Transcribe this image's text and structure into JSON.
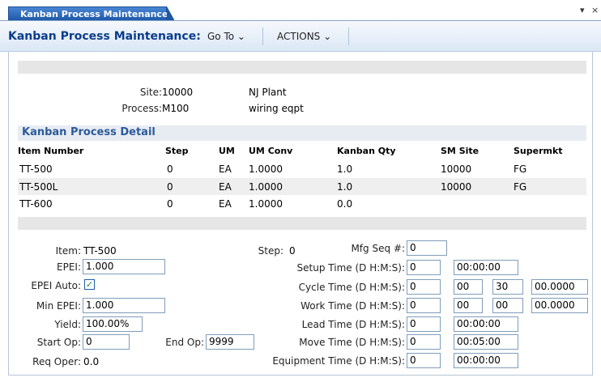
{
  "tab": {
    "title": "Kanban Process Maintenance",
    "dropdown_icon": "▾",
    "close_icon": "×"
  },
  "menubar": {
    "title": "Kanban Process Maintenance:",
    "goto": "Go To ⌄",
    "actions": "ACTIONS ⌄"
  },
  "header": {
    "site_label": "Site:",
    "site_value": "10000",
    "site_desc": "NJ Plant",
    "process_label": "Process:",
    "process_value": "M100",
    "process_desc": "wiring eqpt"
  },
  "detail": {
    "title": "Kanban Process Detail",
    "columns": [
      "Item Number",
      "Step",
      "UM",
      "UM Conv",
      "Kanban Qty",
      "SM Site",
      "Supermkt"
    ],
    "rows": [
      [
        "TT-500",
        "0",
        "EA",
        "1.0000",
        "1.0",
        "10000",
        "FG"
      ],
      [
        "TT-500L",
        "0",
        "EA",
        "1.0000",
        "1.0",
        "10000",
        "FG"
      ],
      [
        "TT-600",
        "0",
        "EA",
        "1.0000",
        "0.0",
        "",
        ""
      ]
    ]
  },
  "form": {
    "item_label": "Item:",
    "item_value": "TT-500",
    "epei_label": "EPEI:",
    "epei_value": "1.000",
    "epei_auto_label": "EPEI Auto:",
    "epei_auto_check": "✓",
    "min_epei_label": "Min EPEI:",
    "min_epei_value": "1.000",
    "yield_label": "Yield:",
    "yield_value": "100.00%",
    "start_op_label": "Start Op:",
    "start_op_value": "0",
    "end_op_label": "End Op:",
    "end_op_value": "9999",
    "req_oper_label": "Req Oper:",
    "req_oper_value": "0.0",
    "step_label": "Step:",
    "step_value": "0",
    "mfg_seq_label": "Mfg Seq #:",
    "mfg_seq_value": "0",
    "setup_label": "Setup Time (D H:M:S):",
    "setup_d": "0",
    "setup_hms": "00:00:00",
    "cycle_label": "Cycle Time (D H:M:S):",
    "cycle_d": "0",
    "cycle_h": "00",
    "cycle_m": "30",
    "cycle_s": "00.0000",
    "work_label": "Work Time (D H:M:S):",
    "work_d": "0",
    "work_h": "00",
    "work_m": "00",
    "work_s": "00.0000",
    "lead_label": "Lead Time (D H:M:S):",
    "lead_d": "0",
    "lead_hms": "00:00:00",
    "move_label": "Move Time (D H:M:S):",
    "move_d": "0",
    "move_hms": "00:05:00",
    "equip_label": "Equipment Time (D H:M:S):",
    "equip_d": "0",
    "equip_hms": "00:00:00"
  }
}
